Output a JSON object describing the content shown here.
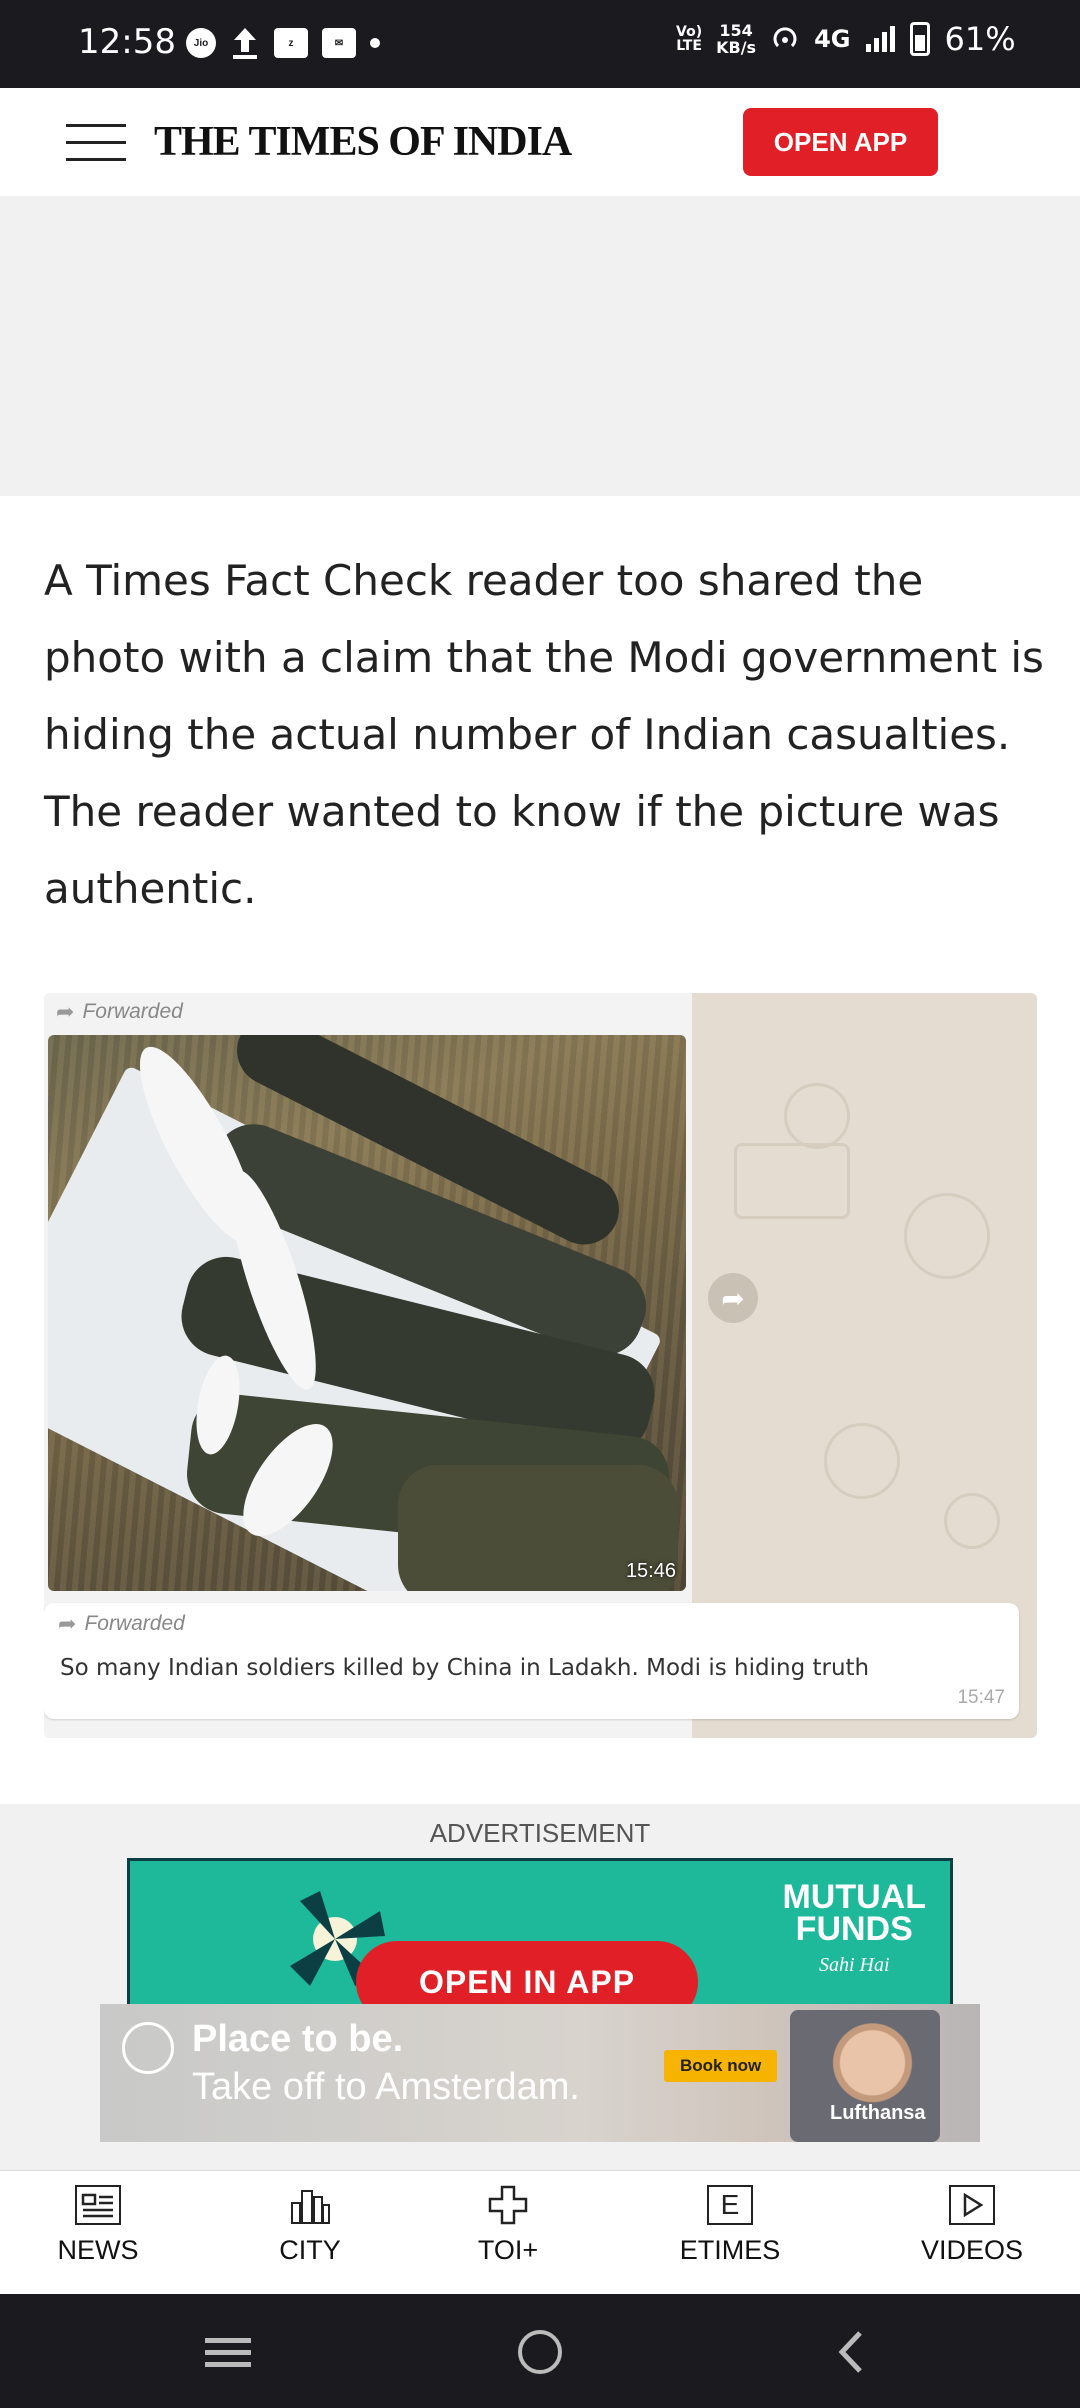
{
  "status_bar": {
    "time": "12:58",
    "notification_icons": [
      "jio-icon",
      "upload-icon",
      "zomato-icon",
      "app-icon"
    ],
    "volte": "Vo) LTE",
    "speed_value": "154",
    "speed_unit": "KB/s",
    "network": "4G",
    "battery": "61%"
  },
  "header": {
    "logo": "THE TIMES OF INDIA",
    "open_app": "OPEN APP"
  },
  "article": {
    "paragraph": "A Times Fact Check reader too shared the photo with a claim that the Modi government is hiding the actual number of Indian casualties. The reader wanted to know if the picture was authentic."
  },
  "whatsapp_image": {
    "forwarded_label_top": "Forwarded",
    "photo_time": "15:46",
    "forwarded_label_msg": "Forwarded",
    "message": "So many Indian soldiers killed by China in Ladakh. Modi is hiding truth",
    "message_time": "15:47"
  },
  "advertisement": {
    "label": "ADVERTISEMENT",
    "mf_line1": "MUTUAL",
    "mf_line2": "FUNDS",
    "mf_tagline": "Sahi Hai",
    "open_in_app": "OPEN IN APP",
    "lh_line1": "Place to be.",
    "lh_line2": "Take off to Amsterdam.",
    "lh_cta": "Book now",
    "lh_brand": "Lufthansa"
  },
  "bottom_nav": [
    {
      "label": "NEWS",
      "icon": "news-icon"
    },
    {
      "label": "CITY",
      "icon": "city-icon"
    },
    {
      "label": "TOI+",
      "icon": "toi-plus-icon"
    },
    {
      "label": "ETIMES",
      "icon": "etimes-icon"
    },
    {
      "label": "VIDEOS",
      "icon": "videos-icon"
    }
  ],
  "colors": {
    "brand_red": "#e11f26",
    "status_bar": "#1b1b1f",
    "ad_bg": "#f1f1f1"
  }
}
